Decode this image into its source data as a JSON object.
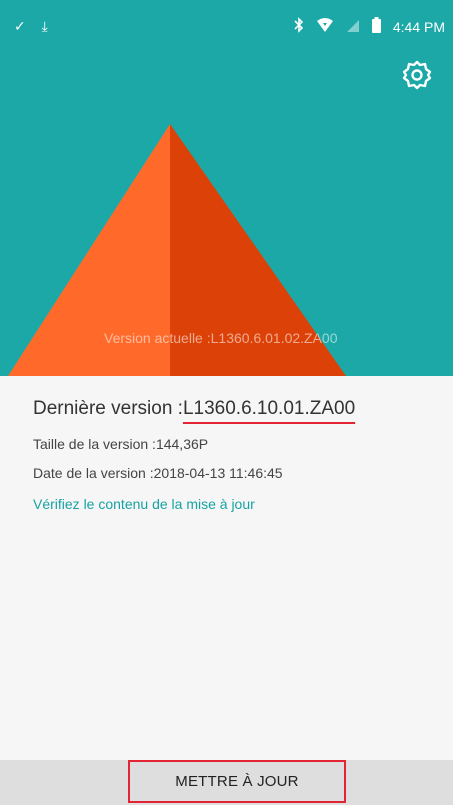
{
  "statusbar": {
    "left_icons": [
      "check-icon",
      "upload-icon"
    ],
    "right_icons": [
      "bluetooth-icon",
      "wifi-icon",
      "no-signal-icon",
      "battery-icon"
    ],
    "time": "4:44 PM"
  },
  "hero": {
    "current_version": "Version actuelle :L1360.6.01.02.ZA00",
    "colors": {
      "background": "#1ba8a7",
      "pyramid_light": "#ff6a2b",
      "pyramid_dark": "#dc4208"
    }
  },
  "info": {
    "latest_label": "Dernière version :",
    "latest_value": "L1360.6.10.01.ZA00",
    "size": "Taille de la version :144,36P",
    "date": "Date de la version :2018-04-13 11:46:45",
    "details_link": "Vérifiez le contenu de la mise à jour"
  },
  "action": {
    "update_label": "METTRE À JOUR"
  },
  "colors": {
    "accent": "#17a2a1",
    "highlight": "#e32434"
  }
}
